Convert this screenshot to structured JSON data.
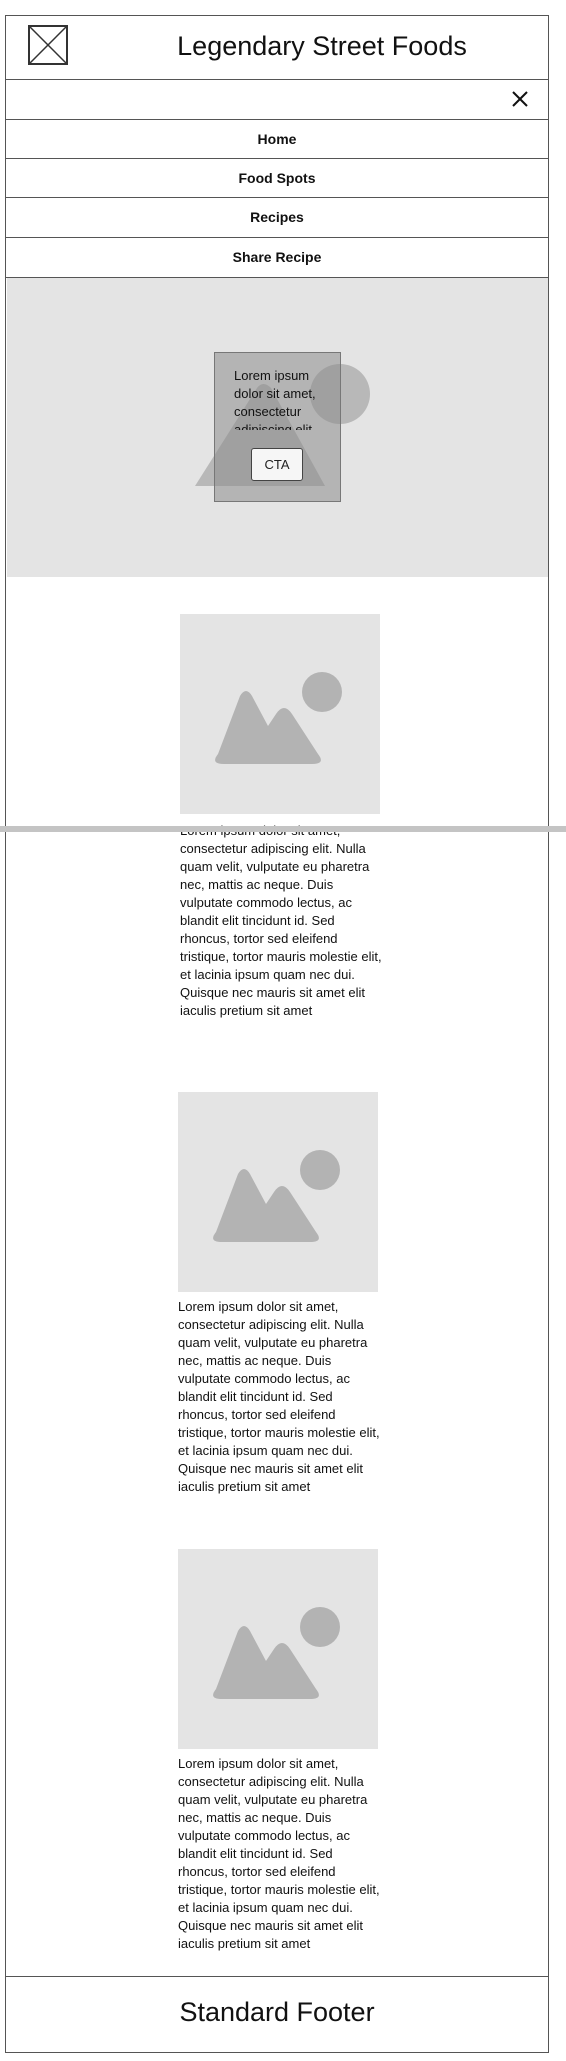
{
  "header": {
    "title": "Legendary Street Foods",
    "logo_icon": "image-placeholder-icon"
  },
  "close_icon": "close-icon",
  "nav": {
    "items": [
      {
        "label": "Home"
      },
      {
        "label": "Food Spots"
      },
      {
        "label": "Recipes"
      },
      {
        "label": "Share Recipe"
      }
    ]
  },
  "hero": {
    "text": "Lorem ipsum dolor sit amet, consectetur adipiscing elit.",
    "cta_label": "CTA"
  },
  "cards": [
    {
      "image_icon": "image-placeholder-icon",
      "text": "Lorem ipsum dolor sit amet, consectetur adipiscing elit. Nulla quam velit, vulputate eu pharetra nec, mattis ac neque. Duis vulputate commodo lectus, ac blandit elit tincidunt id. Sed rhoncus, tortor sed eleifend tristique, tortor mauris molestie elit, et lacinia ipsum quam nec dui. Quisque nec mauris sit amet elit iaculis pretium sit amet"
    },
    {
      "image_icon": "image-placeholder-icon",
      "text": "Lorem ipsum dolor sit amet, consectetur adipiscing elit. Nulla quam velit, vulputate eu pharetra nec, mattis ac neque. Duis vulputate commodo lectus, ac blandit elit tincidunt id. Sed rhoncus, tortor sed eleifend tristique, tortor mauris molestie elit, et lacinia ipsum quam nec dui. Quisque nec mauris sit amet elit iaculis pretium sit amet"
    },
    {
      "image_icon": "image-placeholder-icon",
      "text": "Lorem ipsum dolor sit amet, consectetur adipiscing elit. Nulla quam velit, vulputate eu pharetra nec, mattis ac neque. Duis vulputate commodo lectus, ac blandit elit tincidunt id. Sed rhoncus, tortor sed eleifend tristique, tortor mauris molestie elit, et lacinia ipsum quam nec dui. Quisque nec mauris sit amet elit iaculis pretium sit amet"
    }
  ],
  "footer": {
    "title": "Standard Footer"
  },
  "colors": {
    "placeholder_bg": "#e4e4e4",
    "placeholder_shape": "#b3b3b3",
    "border": "#555555"
  }
}
